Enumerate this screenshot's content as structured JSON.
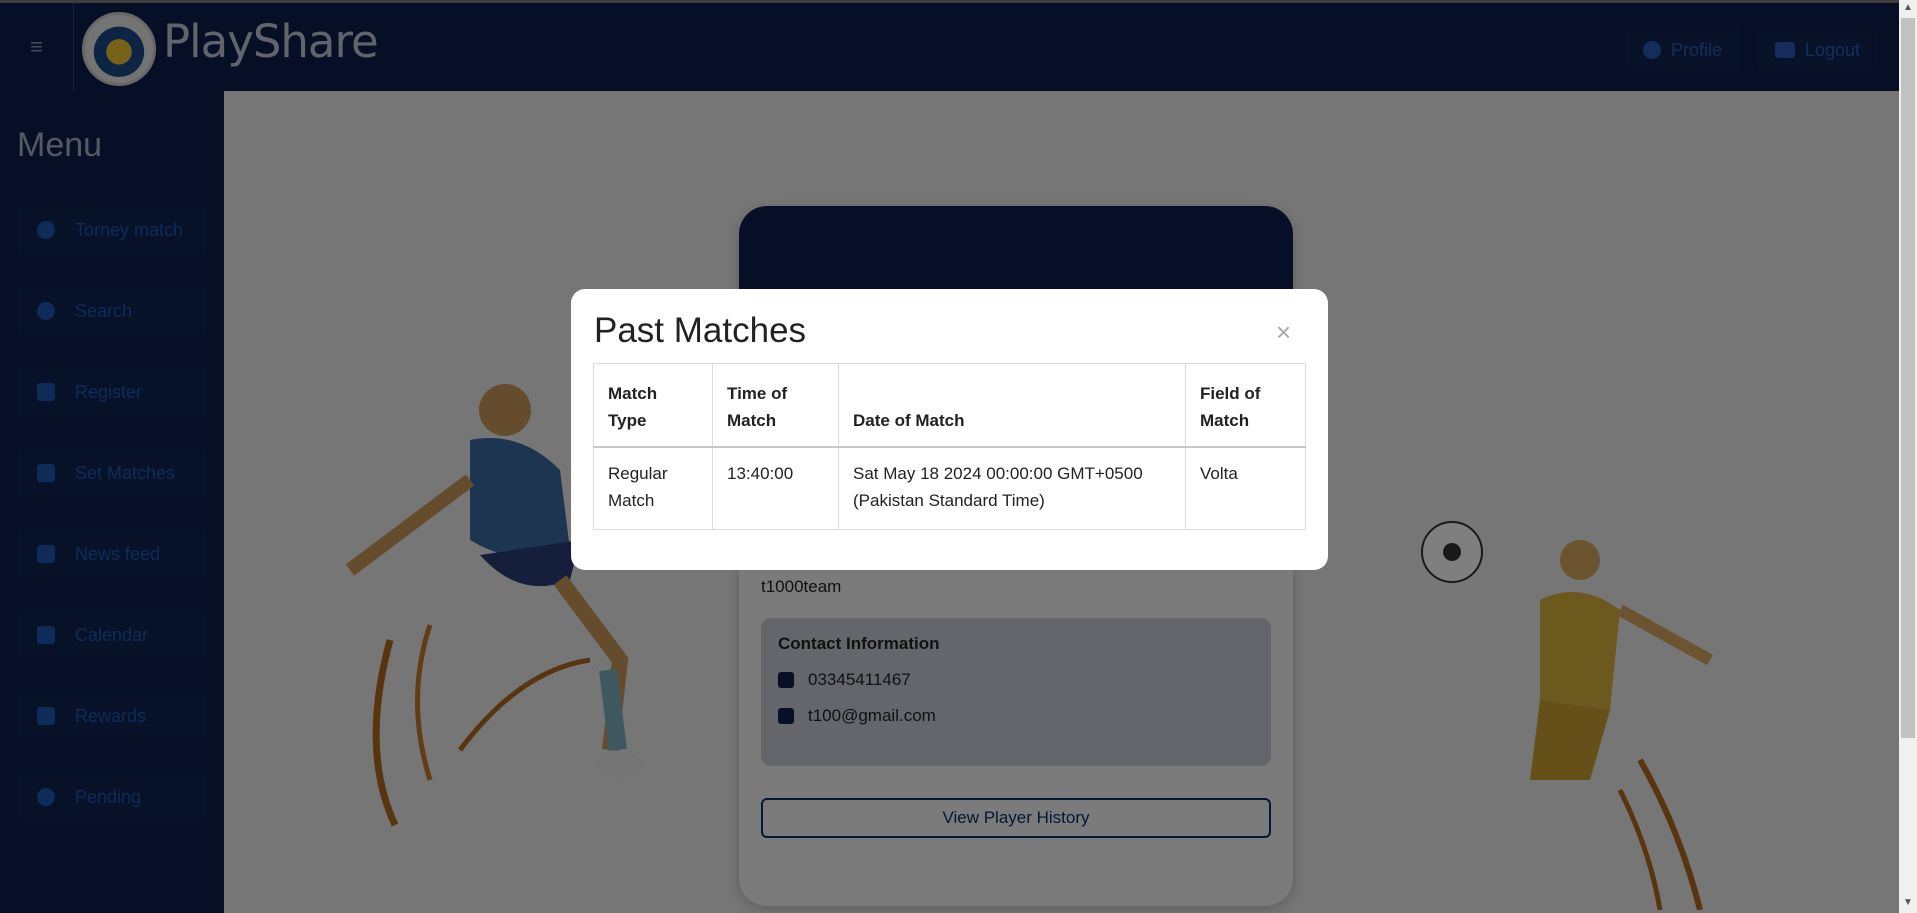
{
  "app": {
    "brand": "PlayShare",
    "hamburger_glyph": "≡",
    "logo_icon": "playshare-logo"
  },
  "nav": {
    "profile_label": "Profile",
    "logout_label": "Logout"
  },
  "sidebar": {
    "title": "Menu",
    "items": [
      {
        "label": "Torney match",
        "icon": "user-icon"
      },
      {
        "label": "Search",
        "icon": "search-icon"
      },
      {
        "label": "Register",
        "icon": "user-plus-icon"
      },
      {
        "label": "Set Matches",
        "icon": "user-plus-icon"
      },
      {
        "label": "News feed",
        "icon": "book-icon"
      },
      {
        "label": "Calendar",
        "icon": "calendar-icon"
      },
      {
        "label": "Rewards",
        "icon": "trophy-icon"
      },
      {
        "label": "Pending",
        "icon": "question-icon"
      }
    ]
  },
  "card": {
    "team_name": "t1000team",
    "contact_title": "Contact Information",
    "phone": "03345411467",
    "email": "t100@gmail.com",
    "history_button": "View Player History"
  },
  "modal": {
    "title": "Past Matches",
    "close_glyph": "×",
    "headers": [
      "Match Type",
      "Time of Match",
      "Date of Match",
      "Field of Match"
    ],
    "rows": [
      [
        "Regular Match",
        "13:40:00",
        "Sat May 18 2024 00:00:00 GMT+0500 (Pakistan Standard Time)",
        "Volta"
      ]
    ]
  },
  "colors": {
    "navy": "#0c1f4a",
    "accent_blue": "#1f57b5"
  }
}
